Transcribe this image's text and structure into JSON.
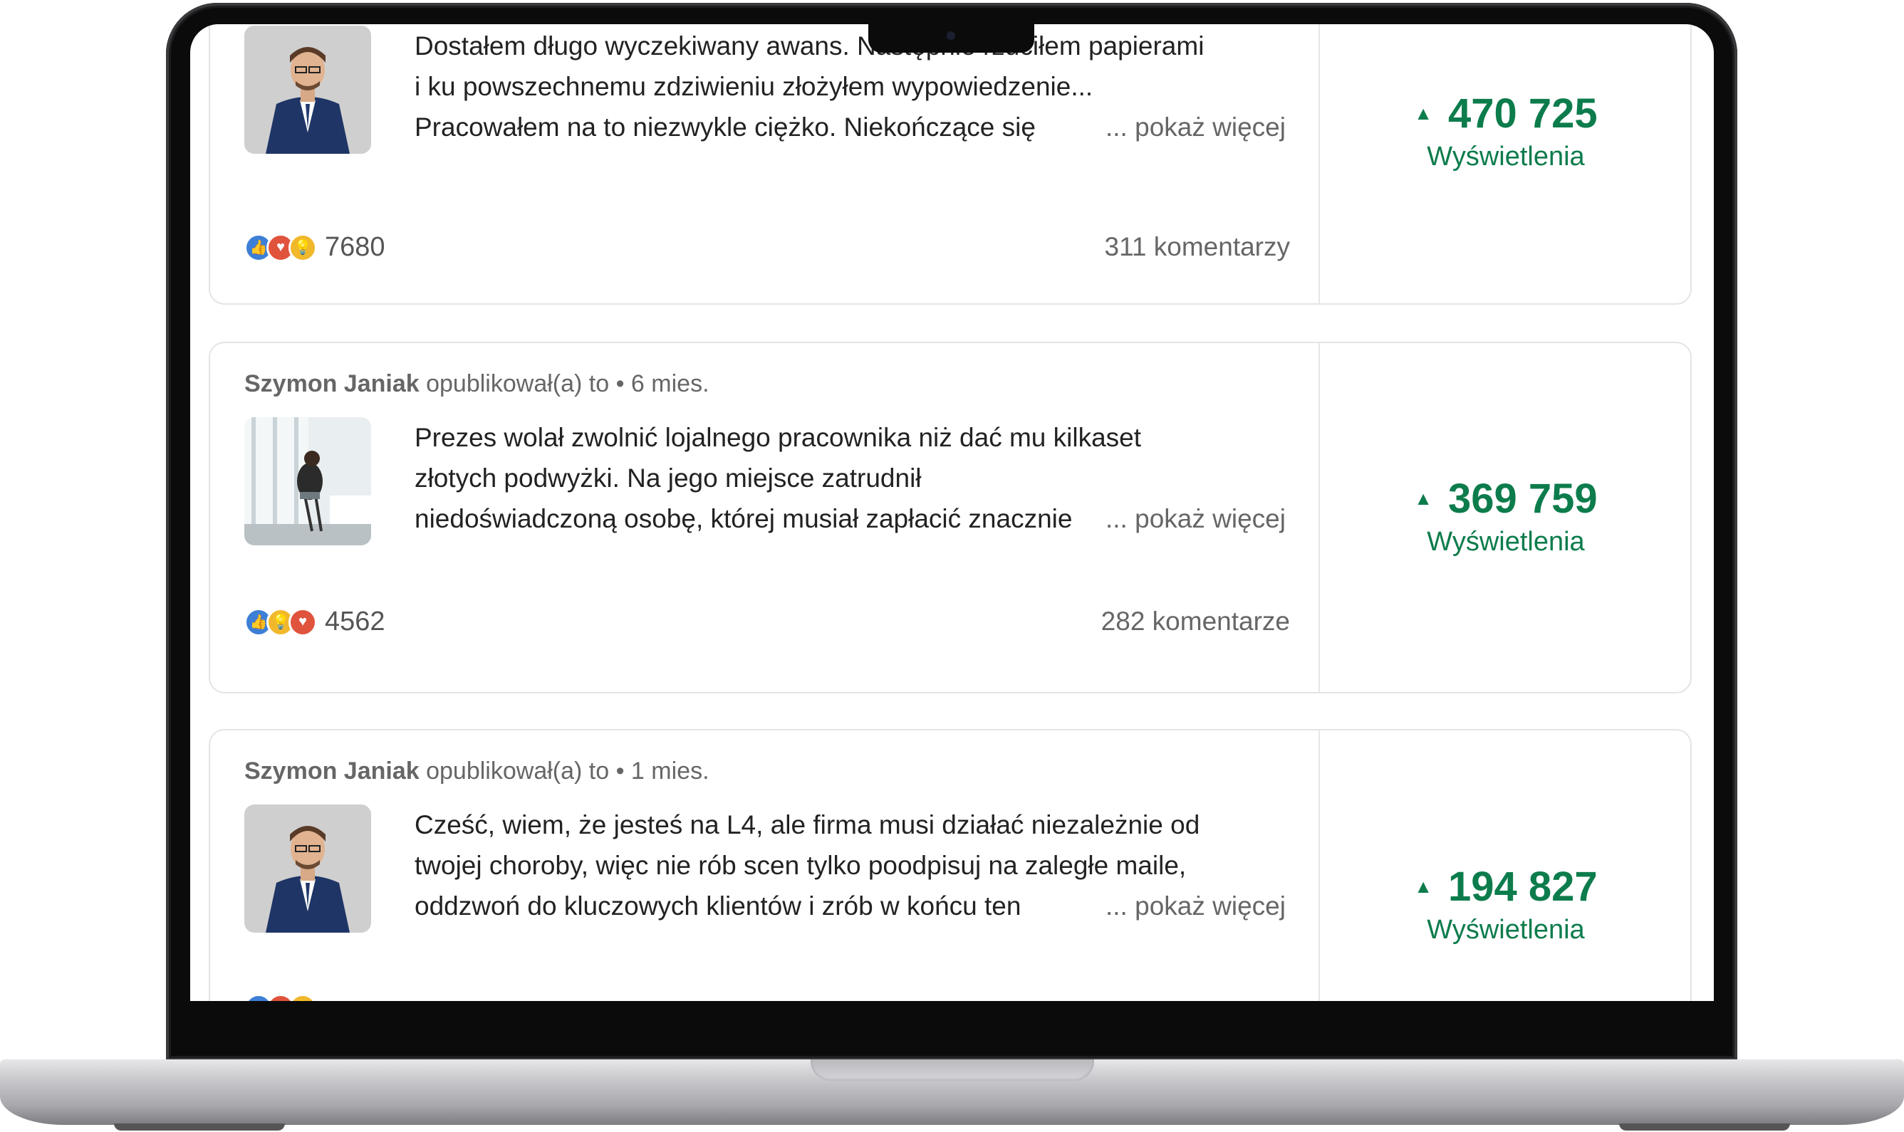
{
  "posts": [
    {
      "author": "",
      "meta_suffix": "",
      "text_lines": [
        "Dostałem długo wyczekiwany awans. Następnie rzuciłem papierami",
        "i ku powszechnemu zdziwieniu złożyłem wypowiedzenie...",
        "Pracowałem na to niezwykle ciężko. Niekończące się"
      ],
      "more_label": "... pokaż więcej",
      "reaction_count": "7680",
      "comments_label": "311 komentarzy",
      "views": "470 725",
      "views_label": "Wyświetlenia",
      "thumb_icon": "man-in-suit-photo"
    },
    {
      "author": "Szymon Janiak",
      "meta_suffix": "opublikował(a) to • 6 mies.",
      "text_lines": [
        "Prezes wolał zwolnić lojalnego pracownika niż dać mu kilkaset",
        "złotych podwyżki. Na jego miejsce zatrudnił",
        "niedoświadczoną osobę, której musiał zapłacić znacznie"
      ],
      "more_label": "... pokaż więcej",
      "reaction_count": "4562",
      "comments_label": "282 komentarze",
      "views": "369 759",
      "views_label": "Wyświetlenia",
      "thumb_icon": "woman-by-window-photo"
    },
    {
      "author": "Szymon Janiak",
      "meta_suffix": "opublikował(a) to • 1 mies.",
      "text_lines": [
        "Cześć, wiem, że jesteś na L4, ale firma musi działać niezależnie od",
        "twojej choroby, więc nie rób scen tylko poodpisuj na zaległe maile,",
        "oddzwoń do kluczowych klientów i zrób w końcu ten"
      ],
      "more_label": "... pokaż więcej",
      "reaction_count": "",
      "comments_label": "",
      "views": "194 827",
      "views_label": "Wyświetlenia",
      "thumb_icon": "man-in-suit-photo"
    }
  ],
  "colors": {
    "accent_green": "#0d7c4c",
    "like_blue": "#3d7fd6",
    "love_red": "#e0533d",
    "insight_yellow": "#f1b82c"
  }
}
